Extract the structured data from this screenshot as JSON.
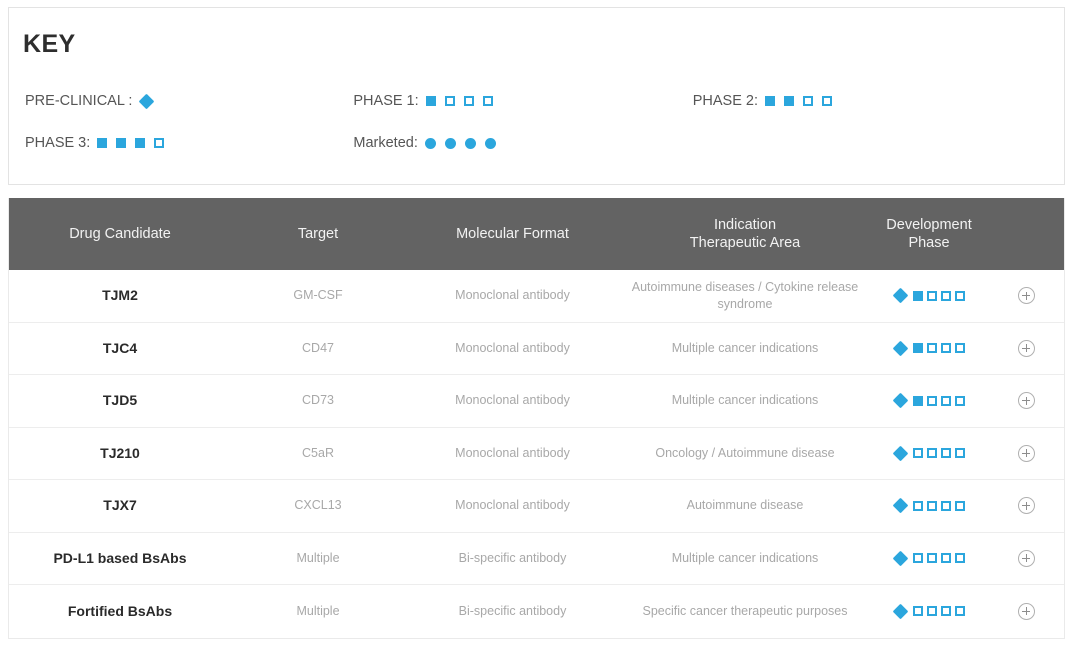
{
  "key": {
    "title": "KEY",
    "accent_color": "#2ba6dd",
    "header_bg_color": "#636363",
    "entries": [
      {
        "label": "PRE-CLINICAL :",
        "markers": [
          "diamond"
        ]
      },
      {
        "label": "PHASE 1:",
        "markers": [
          "sq-filled",
          "sq-open",
          "sq-open",
          "sq-open"
        ]
      },
      {
        "label": "PHASE 2:",
        "markers": [
          "sq-filled",
          "sq-filled",
          "sq-open",
          "sq-open"
        ]
      },
      {
        "label": "PHASE 3:",
        "markers": [
          "sq-filled",
          "sq-filled",
          "sq-filled",
          "sq-open"
        ]
      },
      {
        "label": "Marketed:",
        "markers": [
          "circle",
          "circle",
          "circle",
          "circle"
        ]
      }
    ]
  },
  "table": {
    "columns": [
      {
        "id": "drug",
        "label": "Drug Candidate"
      },
      {
        "id": "target",
        "label": "Target"
      },
      {
        "id": "format",
        "label": "Molecular Format"
      },
      {
        "id": "ind",
        "label": "Indication\nTherapeutic Area"
      },
      {
        "id": "phase",
        "label": "Development\nPhase"
      },
      {
        "id": "plus",
        "label": ""
      }
    ],
    "rows": [
      {
        "drug": "TJM2",
        "target": "GM-CSF",
        "format": "Monoclonal antibody",
        "indication": "Autoimmune diseases / Cytokine release syndrome",
        "phase_markers": [
          "diamond",
          "sq-filled",
          "sq-open",
          "sq-open",
          "sq-open"
        ],
        "expand_icon": "plus-circle-icon"
      },
      {
        "drug": "TJC4",
        "target": "CD47",
        "format": "Monoclonal antibody",
        "indication": "Multiple cancer indications",
        "phase_markers": [
          "diamond",
          "sq-filled",
          "sq-open",
          "sq-open",
          "sq-open"
        ],
        "expand_icon": "plus-circle-icon"
      },
      {
        "drug": "TJD5",
        "target": "CD73",
        "format": "Monoclonal antibody",
        "indication": "Multiple cancer indications",
        "phase_markers": [
          "diamond",
          "sq-filled",
          "sq-open",
          "sq-open",
          "sq-open"
        ],
        "expand_icon": "plus-circle-icon"
      },
      {
        "drug": "TJ210",
        "target": "C5aR",
        "format": "Monoclonal antibody",
        "indication": "Oncology / Autoimmune disease",
        "phase_markers": [
          "diamond",
          "sq-open",
          "sq-open",
          "sq-open",
          "sq-open"
        ],
        "expand_icon": "plus-circle-icon"
      },
      {
        "drug": "TJX7",
        "target": "CXCL13",
        "format": "Monoclonal antibody",
        "indication": "Autoimmune disease",
        "phase_markers": [
          "diamond",
          "sq-open",
          "sq-open",
          "sq-open",
          "sq-open"
        ],
        "expand_icon": "plus-circle-icon"
      },
      {
        "drug": "PD-L1 based BsAbs",
        "target": "Multiple",
        "format": "Bi-specific antibody",
        "indication": "Multiple cancer indications",
        "phase_markers": [
          "diamond",
          "sq-open",
          "sq-open",
          "sq-open",
          "sq-open"
        ],
        "expand_icon": "plus-circle-icon"
      },
      {
        "drug": "Fortified BsAbs",
        "target": "Multiple",
        "format": "Bi-specific antibody",
        "indication": "Specific cancer therapeutic purposes",
        "phase_markers": [
          "diamond",
          "sq-open",
          "sq-open",
          "sq-open",
          "sq-open"
        ],
        "expand_icon": "plus-circle-icon"
      }
    ]
  }
}
